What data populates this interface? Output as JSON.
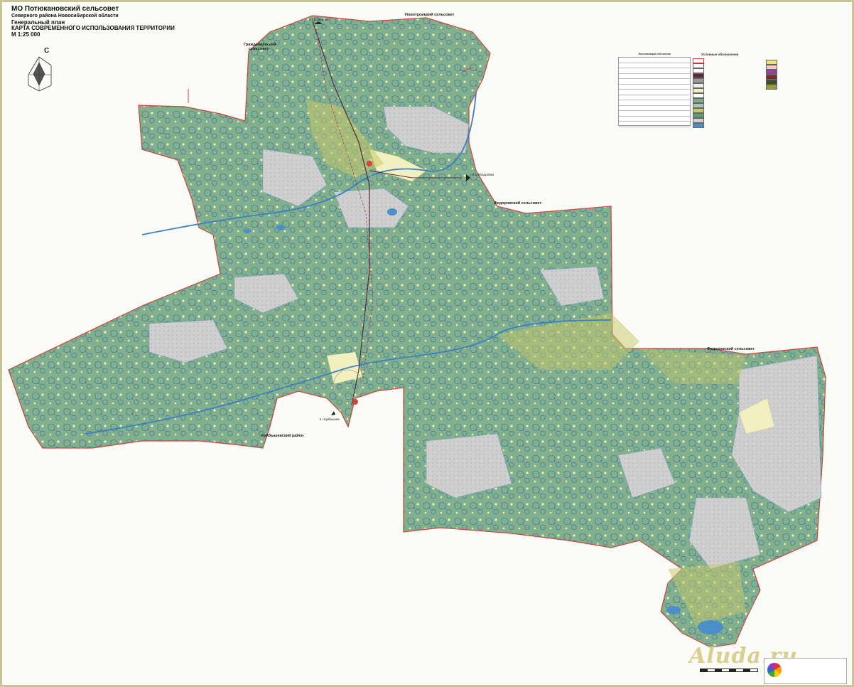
{
  "title": {
    "line1": "МО Потюкановский сельсовет",
    "line2": "Северного района Новосибирской области",
    "line3": "Генеральный план",
    "line4": "КАРТА СОВРЕМЕННОГО ИСПОЛЬЗОВАНИЯ ТЕРРИТОРИИ",
    "line5": "М 1:25 000"
  },
  "compass": {
    "north_letter": "С"
  },
  "neighbors": {
    "grozhdensky": "Гражданцевский сельсовет",
    "novotroitsky": "Новотроицкий сельсовет",
    "fedorovsky_1": "Федоровский сельсовет",
    "fedorovsky_2": "Федоровский сельсовет",
    "kuibyshevsky": "Куйбышевский район"
  },
  "directions": {
    "to_severnoe": "в с.Северное",
    "to_fedorovka": "в с.Федоровка",
    "to_kuibyshev": "в г.Куйбышев"
  },
  "legend": {
    "explication_title": "Экспликация объектов",
    "symbols_title": "Условные обозначения"
  },
  "watermark": "Aluda.ru",
  "colors": {
    "forest": "#7fad8a",
    "forest_dark": "#5f9a7b",
    "meadow": "#f2f0c0",
    "swamp": "#c9c9c9",
    "water": "#4a8fc8",
    "boundary": "#d1443a",
    "wetland_yellow": "#c8c86a"
  }
}
